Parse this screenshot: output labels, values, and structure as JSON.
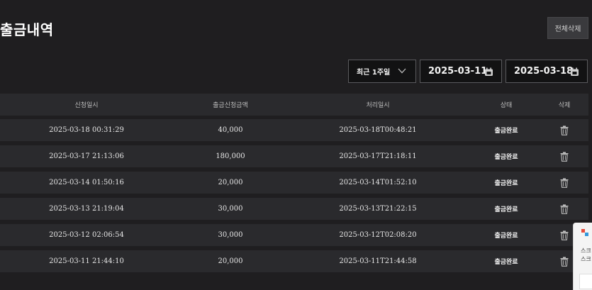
{
  "page": {
    "title": "출금내역"
  },
  "toolbar": {
    "delete_all_label": "전체삭제"
  },
  "filters": {
    "period": "최근 1주일",
    "start_date": "2025-03-11",
    "end_date": "2025-03-18"
  },
  "table": {
    "headers": [
      "신청일시",
      "출금신청금액",
      "처리일시",
      "상태",
      "삭제"
    ],
    "rows": [
      {
        "requested": "2025-03-18 00:31:29",
        "amount": "40,000",
        "processed": "2025-03-18T00:48:21",
        "status": "출금완료"
      },
      {
        "requested": "2025-03-17 21:13:06",
        "amount": "180,000",
        "processed": "2025-03-17T21:18:11",
        "status": "출금완료"
      },
      {
        "requested": "2025-03-14 01:50:16",
        "amount": "20,000",
        "processed": "2025-03-14T01:52:10",
        "status": "출금완료"
      },
      {
        "requested": "2025-03-13 21:19:04",
        "amount": "30,000",
        "processed": "2025-03-13T21:22:15",
        "status": "출금완료"
      },
      {
        "requested": "2025-03-12 02:06:54",
        "amount": "30,000",
        "processed": "2025-03-12T02:08:20",
        "status": "출금완료"
      },
      {
        "requested": "2025-03-11 21:44:10",
        "amount": "20,000",
        "processed": "2025-03-11T21:44:58",
        "status": "출금완료"
      }
    ]
  },
  "side_panel": {
    "line1": "스크",
    "line2": "스크"
  },
  "icons": {
    "period_toggle": "chevron-down-icon",
    "calendar": "calendar-icon",
    "delete": "trash-icon"
  },
  "colors": {
    "background": "#1f1e20",
    "row": "#2a2a2d",
    "input_bg": "#121213",
    "input_border": "#5a5a5d"
  }
}
